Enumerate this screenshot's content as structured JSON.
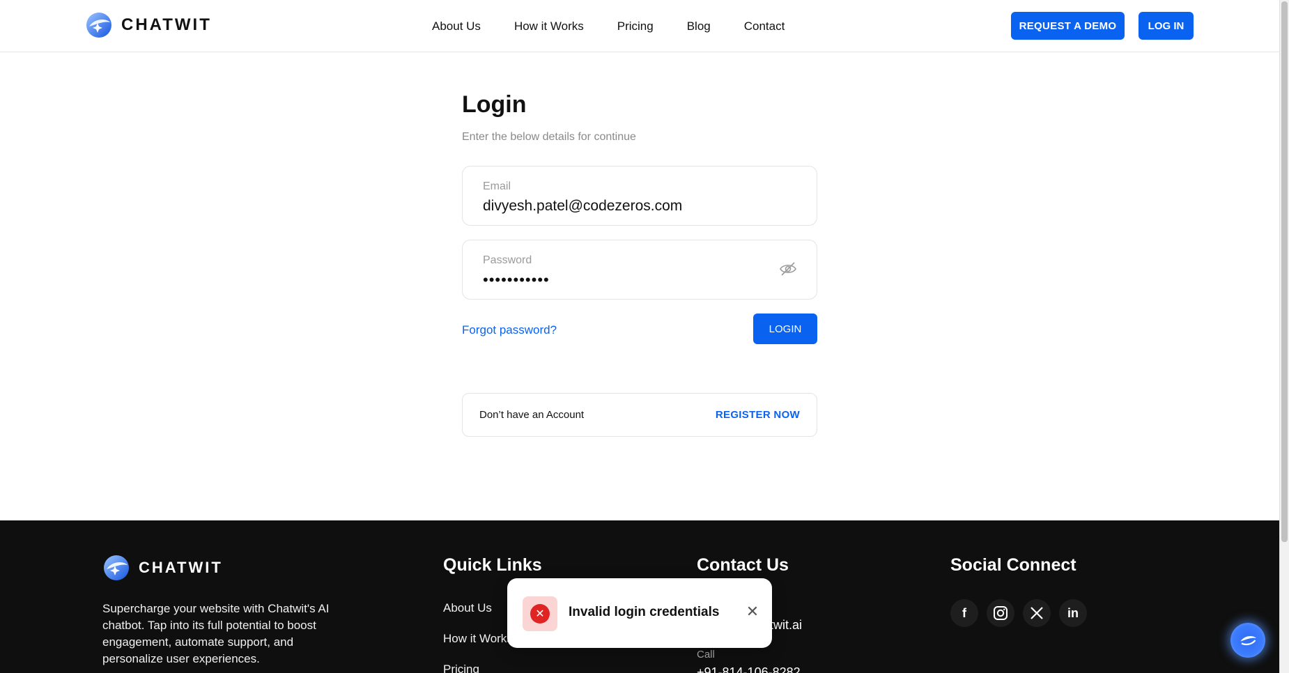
{
  "header": {
    "brand": "CHATWIT",
    "nav": [
      "About Us",
      "How it Works",
      "Pricing",
      "Blog",
      "Contact"
    ],
    "request_demo": "REQUEST A DEMO",
    "log_in": "LOG IN"
  },
  "login": {
    "title": "Login",
    "subtitle": "Enter the below details for continue",
    "email_label": "Email",
    "email_value": "divyesh.patel@codezeros.com",
    "password_label": "Password",
    "password_mask": "•••••••••••",
    "forgot": "Forgot password?",
    "submit": "LOGIN",
    "no_account": "Don’t have an Account",
    "register": "REGISTER NOW"
  },
  "footer": {
    "brand": "CHATWIT",
    "description": "Supercharge your website with Chatwit's AI chatbot. Tap into its full potential to boost engagement, automate support, and personalize user experiences.",
    "quick_links_heading": "Quick Links",
    "quick_links": [
      "About Us",
      "How it Works",
      "Pricing"
    ],
    "contact_heading": "Contact Us",
    "contact_email_partial": "atwit.ai",
    "call_label": "Call",
    "call_value": "+91-814-106-8282",
    "social_heading": "Social Connect",
    "socials": [
      "facebook-icon",
      "instagram-icon",
      "x-icon",
      "linkedin-icon"
    ]
  },
  "toast": {
    "message": "Invalid login credentials"
  },
  "colors": {
    "accent": "#0a63f0",
    "error": "#e02424",
    "footer_bg": "#0f0f0f"
  }
}
